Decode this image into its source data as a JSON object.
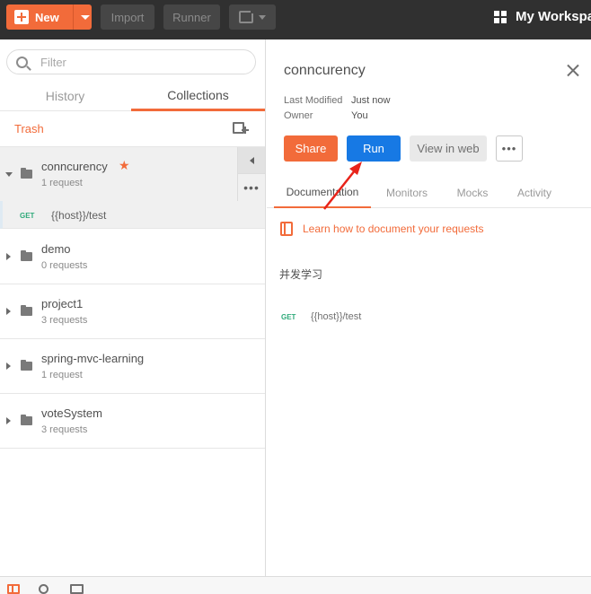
{
  "header": {
    "new_label": "New",
    "import_label": "Import",
    "runner_label": "Runner",
    "workspace_label": "My Workspace"
  },
  "sidebar": {
    "filter_placeholder": "Filter",
    "tabs": [
      {
        "label": "History"
      },
      {
        "label": "Collections"
      }
    ],
    "trash_label": "Trash",
    "collections": [
      {
        "name": "conncurency",
        "count": "1 request"
      },
      {
        "name": "demo",
        "count": "0 requests"
      },
      {
        "name": "project1",
        "count": "3 requests"
      },
      {
        "name": "spring-mvc-learning",
        "count": "1 request"
      },
      {
        "name": "voteSystem",
        "count": "3 requests"
      }
    ],
    "request": {
      "method": "GET",
      "url": "{{host}}/test"
    }
  },
  "detail": {
    "title": "conncurency",
    "meta": [
      {
        "key": "Last Modified",
        "value": "Just now"
      },
      {
        "key": "Owner",
        "value": "You"
      }
    ],
    "buttons": {
      "share": "Share",
      "run": "Run",
      "view_web": "View in web",
      "more": "•••"
    },
    "tabs": [
      {
        "label": "Documentation"
      },
      {
        "label": "Monitors"
      },
      {
        "label": "Mocks"
      },
      {
        "label": "Activity"
      }
    ],
    "learn_link": "Learn how to document your requests",
    "description": "并发学习",
    "request": {
      "method": "GET",
      "url": "{{host}}/test"
    }
  },
  "colors": {
    "accent": "#f26b3a",
    "run_blue": "#1779e4",
    "topbar": "#303030",
    "get_green": "#2faa7a"
  }
}
